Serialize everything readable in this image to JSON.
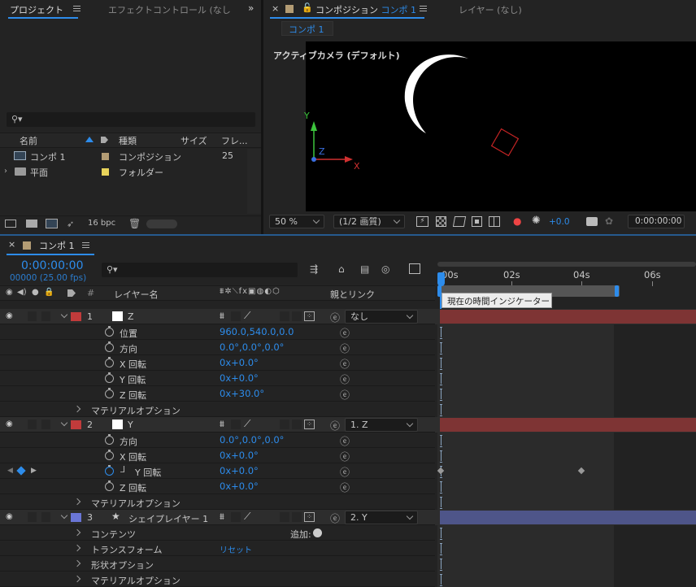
{
  "project_panel": {
    "tab_title": "プロジェクト",
    "effect_tab": "エフェクトコントロール (なし",
    "columns": {
      "name": "名前",
      "type": "種類",
      "size": "サイズ",
      "frame": "フレ..."
    },
    "items": [
      {
        "name": "コンポ 1",
        "type": "コンポジション",
        "frame": "25",
        "icon": "composition-icon",
        "label_color": "#b39c74"
      },
      {
        "name": "平面",
        "type": "フォルダー",
        "frame": "",
        "icon": "folder-icon",
        "label_color": "#e8d35a"
      }
    ],
    "bpc": "16 bpc"
  },
  "composition_panel": {
    "tab_title": "コンポジション",
    "comp_name": "コンポ 1",
    "layer_tab": "レイヤー (なし)",
    "crumb": "コンポ 1",
    "camera_label": "アクティブカメラ (デフォルト)",
    "axes": {
      "x": "X",
      "y": "Y",
      "z": "Z"
    },
    "zoom": "50 %",
    "quality": "(1/2 画質)",
    "exposure": "+0.0",
    "timecode": "0:00:00:00"
  },
  "timeline": {
    "tab_title": "コンポ 1",
    "timecode": "0:00:00:00",
    "frame_info": "00000 (25.00 fps)",
    "header": {
      "layer_name": "レイヤー名",
      "parent": "親とリンク",
      "num": "#"
    },
    "ruler": [
      "00s",
      "02s",
      "04s",
      "06s"
    ],
    "tooltip": "現在の時間インジケーター",
    "accent": "#2d8ceb",
    "rows": [
      {
        "kind": "layer",
        "num": "1",
        "name": "Z",
        "label_color": "#c13b3b",
        "parent": "なし"
      },
      {
        "kind": "prop",
        "name": "位置",
        "value": "960.0,540.0,0.0"
      },
      {
        "kind": "prop",
        "name": "方向",
        "value": "0.0°,0.0°,0.0°"
      },
      {
        "kind": "prop",
        "name": "X 回転",
        "value": "0x+0.0°"
      },
      {
        "kind": "prop",
        "name": "Y 回転",
        "value": "0x+0.0°"
      },
      {
        "kind": "prop",
        "name": "Z 回転",
        "value": "0x+30.0°"
      },
      {
        "kind": "group",
        "name": "マテリアルオプション"
      },
      {
        "kind": "layer",
        "num": "2",
        "name": "Y",
        "label_color": "#c13b3b",
        "parent": "1. Z"
      },
      {
        "kind": "prop",
        "name": "方向",
        "value": "0.0°,0.0°,0.0°"
      },
      {
        "kind": "prop",
        "name": "X 回転",
        "value": "0x+0.0°"
      },
      {
        "kind": "prop",
        "name": "Y 回転",
        "value": "0x+0.0°",
        "keyed": true
      },
      {
        "kind": "prop",
        "name": "Z 回転",
        "value": "0x+0.0°"
      },
      {
        "kind": "group",
        "name": "マテリアルオプション"
      },
      {
        "kind": "layer",
        "num": "3",
        "name": "シェイプレイヤー 1",
        "label_color": "#6a76d6",
        "parent": "2. Y"
      },
      {
        "kind": "group",
        "name": "コンテンツ",
        "extra": "追加:"
      },
      {
        "kind": "group",
        "name": "トランスフォーム",
        "extra": "リセット"
      },
      {
        "kind": "group",
        "name": "形状オプション"
      },
      {
        "kind": "group",
        "name": "マテリアルオプション"
      }
    ]
  }
}
